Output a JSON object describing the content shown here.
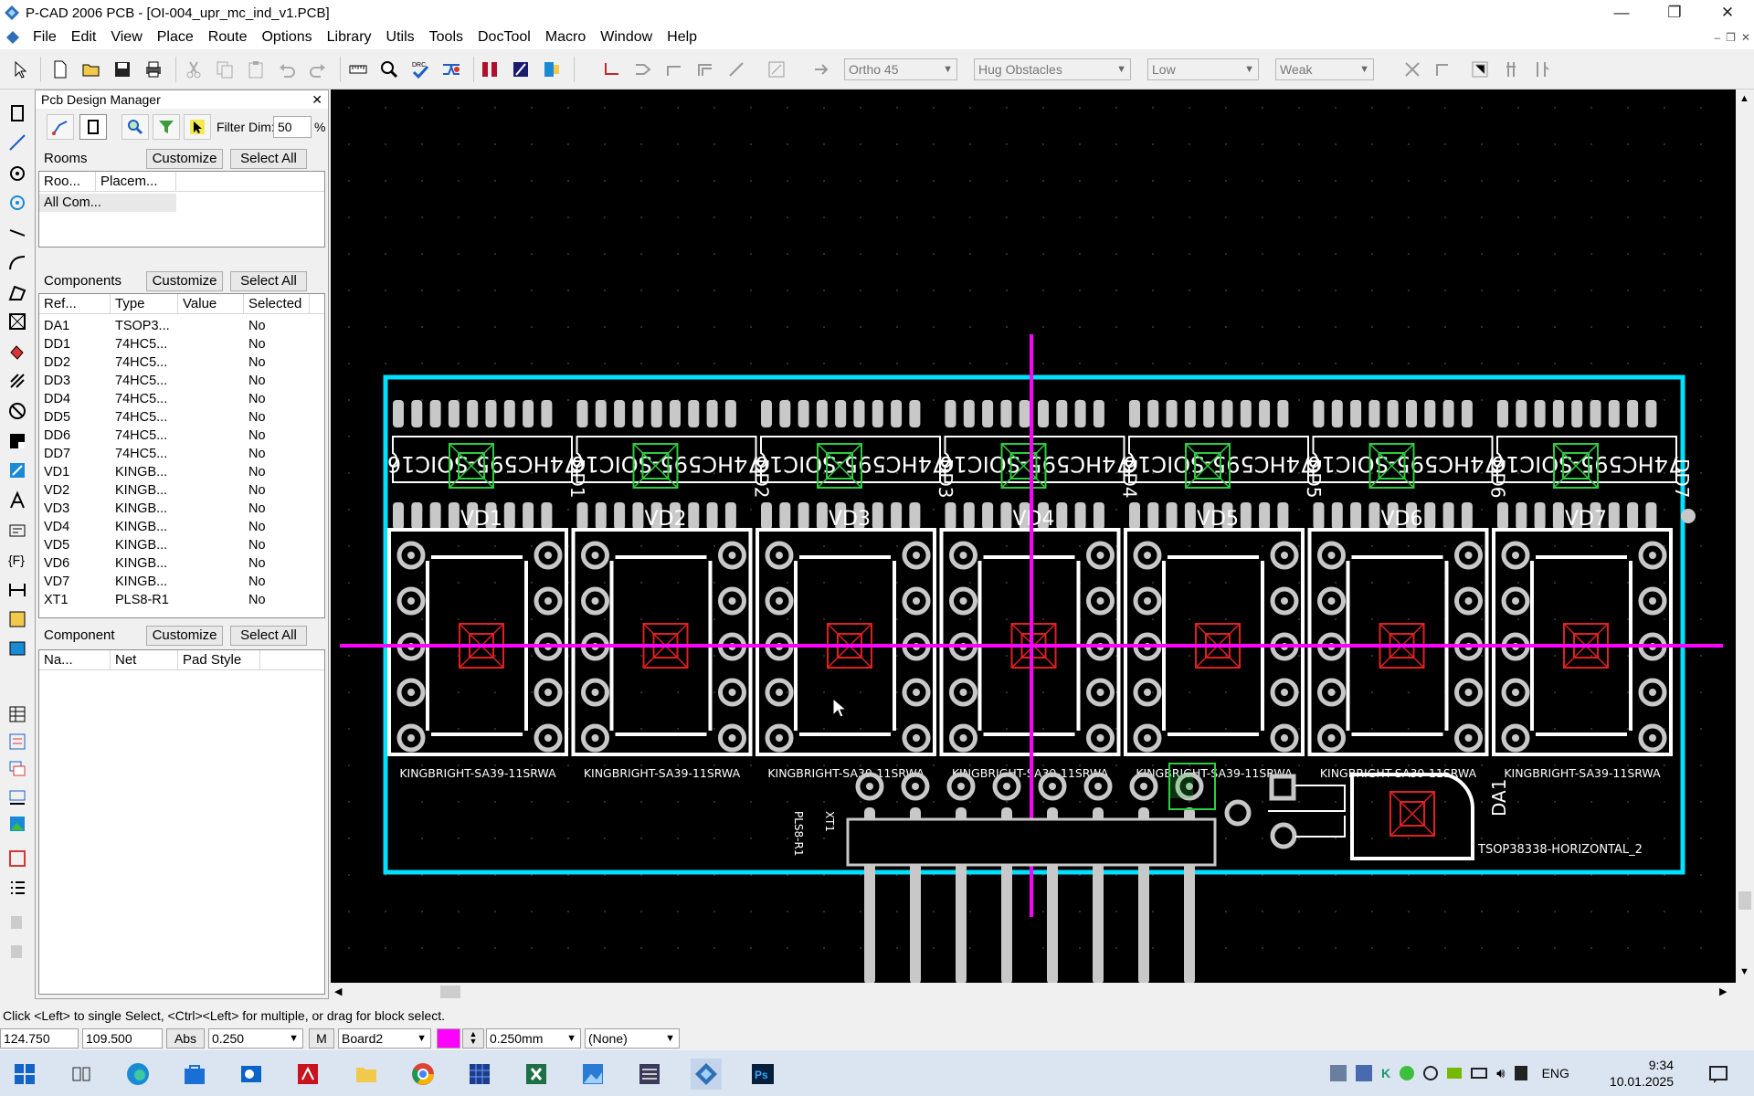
{
  "window": {
    "title": "P-CAD 2006 PCB - [OI-004_upr_mc_ind_v1.PCB]"
  },
  "menu": [
    "File",
    "Edit",
    "View",
    "Place",
    "Route",
    "Options",
    "Library",
    "Utils",
    "Tools",
    "DocTool",
    "Macro",
    "Window",
    "Help"
  ],
  "toolbar": {
    "ortho": "Ortho 45",
    "obstacle": "Hug Obstacles",
    "effort": "Low",
    "strength": "Weak"
  },
  "manager": {
    "title": "Pcb Design Manager",
    "filter_label": "Filter Dim:",
    "filter_value": "50",
    "filter_unit": "%",
    "rooms": {
      "label": "Rooms",
      "customize": "Customize",
      "select_all": "Select All",
      "cols": [
        "Roo...",
        "Placem..."
      ],
      "rows": [
        "All Com..."
      ]
    },
    "components": {
      "label": "Components",
      "customize": "Customize",
      "select_all": "Select All",
      "cols": [
        "Ref...",
        "Type",
        "Value",
        "Selected"
      ],
      "rows": [
        {
          "ref": "DA1",
          "type": "TSOP3...",
          "value": "",
          "sel": "No"
        },
        {
          "ref": "DD1",
          "type": "74HC5...",
          "value": "",
          "sel": "No"
        },
        {
          "ref": "DD2",
          "type": "74HC5...",
          "value": "",
          "sel": "No"
        },
        {
          "ref": "DD3",
          "type": "74HC5...",
          "value": "",
          "sel": "No"
        },
        {
          "ref": "DD4",
          "type": "74HC5...",
          "value": "",
          "sel": "No"
        },
        {
          "ref": "DD5",
          "type": "74HC5...",
          "value": "",
          "sel": "No"
        },
        {
          "ref": "DD6",
          "type": "74HC5...",
          "value": "",
          "sel": "No"
        },
        {
          "ref": "DD7",
          "type": "74HC5...",
          "value": "",
          "sel": "No"
        },
        {
          "ref": "VD1",
          "type": "KINGB...",
          "value": "",
          "sel": "No"
        },
        {
          "ref": "VD2",
          "type": "KINGB...",
          "value": "",
          "sel": "No"
        },
        {
          "ref": "VD3",
          "type": "KINGB...",
          "value": "",
          "sel": "No"
        },
        {
          "ref": "VD4",
          "type": "KINGB...",
          "value": "",
          "sel": "No"
        },
        {
          "ref": "VD5",
          "type": "KINGB...",
          "value": "",
          "sel": "No"
        },
        {
          "ref": "VD6",
          "type": "KINGB...",
          "value": "",
          "sel": "No"
        },
        {
          "ref": "VD7",
          "type": "KINGB...",
          "value": "",
          "sel": "No"
        },
        {
          "ref": "XT1",
          "type": "PLS8-R1",
          "value": "",
          "sel": "No"
        }
      ]
    },
    "pins": {
      "label": "Component",
      "customize": "Customize",
      "select_all": "Select All",
      "cols": [
        "Na...",
        "Net",
        "Pad Style"
      ]
    }
  },
  "board": {
    "ic_text": "74HC595-SOIC16",
    "vd_labels": [
      "VD1",
      "VD2",
      "VD3",
      "VD4",
      "VD5",
      "VD6",
      "VD7"
    ],
    "dd_labels": [
      "DD1",
      "DD2",
      "DD3",
      "DD4",
      "DD5",
      "DD6",
      "DD7"
    ],
    "display_label": "KINGBRIGHT-SA39-11SRWA",
    "conn_label": "PLS8-R1",
    "conn_ref": "XT1",
    "da_ref": "DA1",
    "da_label": "TSOP38338-HORIZONTAL_2"
  },
  "status": {
    "hint": "Click <Left> to single Select, <Ctrl><Left> for multiple, or drag for block select.",
    "x": "124.750",
    "y": "109.500",
    "abs": "Abs",
    "grid": "0.250",
    "layer": "Board2",
    "m": "M",
    "width": "0.250mm",
    "net": "(None)"
  },
  "taskbar": {
    "lang": "ENG",
    "time": "9:34",
    "date": "10.01.2025"
  }
}
